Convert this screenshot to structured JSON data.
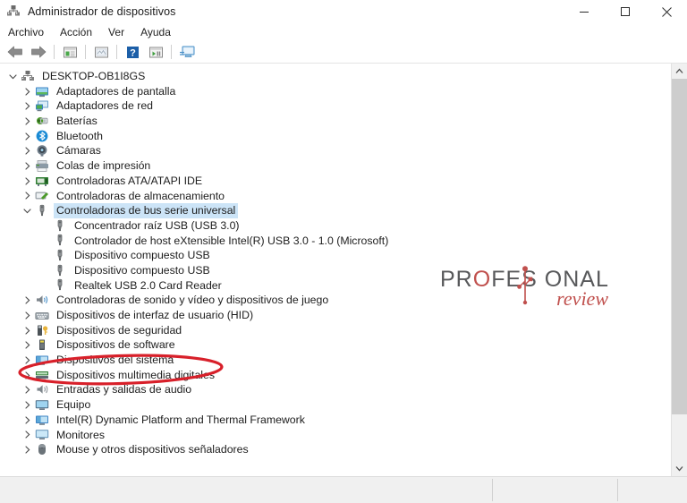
{
  "window": {
    "title": "Administrador de dispositivos",
    "icon": "device-manager-icon",
    "minimize_label": "—",
    "maximize_label": "□",
    "close_label": "✕"
  },
  "menubar": {
    "items": [
      {
        "label": "Archivo",
        "name": "menu-archivo"
      },
      {
        "label": "Acción",
        "name": "menu-accion"
      },
      {
        "label": "Ver",
        "name": "menu-ver"
      },
      {
        "label": "Ayuda",
        "name": "menu-ayuda"
      }
    ]
  },
  "toolbar": {
    "buttons": [
      {
        "name": "back-icon"
      },
      {
        "name": "forward-icon"
      },
      {
        "name": "properties-icon"
      },
      {
        "name": "scan-hardware-icon"
      },
      {
        "name": "help-icon"
      },
      {
        "name": "update-driver-icon"
      },
      {
        "name": "show-hidden-devices-icon"
      }
    ]
  },
  "tree": {
    "root": {
      "label": "DESKTOP-OB1I8GS",
      "expanded": true,
      "icon": "computer-icon"
    },
    "items": [
      {
        "label": "Adaptadores de pantalla",
        "depth": 1,
        "expanded": false,
        "icon": "display-adapter-icon",
        "selected": false
      },
      {
        "label": "Adaptadores de red",
        "depth": 1,
        "expanded": false,
        "icon": "network-adapter-icon",
        "selected": false
      },
      {
        "label": "Baterías",
        "depth": 1,
        "expanded": false,
        "icon": "battery-icon",
        "selected": false
      },
      {
        "label": "Bluetooth",
        "depth": 1,
        "expanded": false,
        "icon": "bluetooth-icon",
        "selected": false
      },
      {
        "label": "Cámaras",
        "depth": 1,
        "expanded": false,
        "icon": "camera-icon",
        "selected": false
      },
      {
        "label": "Colas de impresión",
        "depth": 1,
        "expanded": false,
        "icon": "printer-icon",
        "selected": false
      },
      {
        "label": "Controladoras ATA/ATAPI IDE",
        "depth": 1,
        "expanded": false,
        "icon": "ide-controller-icon",
        "selected": false
      },
      {
        "label": "Controladoras de almacenamiento",
        "depth": 1,
        "expanded": false,
        "icon": "storage-controller-icon",
        "selected": false
      },
      {
        "label": "Controladoras de bus serie universal",
        "depth": 1,
        "expanded": true,
        "icon": "usb-icon",
        "selected": true
      },
      {
        "label": "Concentrador raíz USB (USB 3.0)",
        "depth": 2,
        "expanded": null,
        "icon": "usb-icon",
        "selected": false
      },
      {
        "label": "Controlador de host eXtensible Intel(R) USB 3.0 - 1.0 (Microsoft)",
        "depth": 2,
        "expanded": null,
        "icon": "usb-icon",
        "selected": false
      },
      {
        "label": "Dispositivo compuesto USB",
        "depth": 2,
        "expanded": null,
        "icon": "usb-icon",
        "selected": false
      },
      {
        "label": "Dispositivo compuesto USB",
        "depth": 2,
        "expanded": null,
        "icon": "usb-icon",
        "selected": false
      },
      {
        "label": "Realtek USB 2.0 Card Reader",
        "depth": 2,
        "expanded": null,
        "icon": "usb-icon",
        "selected": false,
        "annotated": true
      },
      {
        "label": "Controladoras de sonido y vídeo y dispositivos de juego",
        "depth": 1,
        "expanded": false,
        "icon": "sound-icon",
        "selected": false
      },
      {
        "label": "Dispositivos de interfaz de usuario (HID)",
        "depth": 1,
        "expanded": false,
        "icon": "hid-icon",
        "selected": false
      },
      {
        "label": "Dispositivos de seguridad",
        "depth": 1,
        "expanded": false,
        "icon": "security-device-icon",
        "selected": false
      },
      {
        "label": "Dispositivos de software",
        "depth": 1,
        "expanded": false,
        "icon": "software-device-icon",
        "selected": false
      },
      {
        "label": "Dispositivos del sistema",
        "depth": 1,
        "expanded": false,
        "icon": "system-device-icon",
        "selected": false
      },
      {
        "label": "Dispositivos multimedia digitales",
        "depth": 1,
        "expanded": false,
        "icon": "multimedia-device-icon",
        "selected": false
      },
      {
        "label": "Entradas y salidas de audio",
        "depth": 1,
        "expanded": false,
        "icon": "audio-io-icon",
        "selected": false
      },
      {
        "label": "Equipo",
        "depth": 1,
        "expanded": false,
        "icon": "computer-monitor-icon",
        "selected": false
      },
      {
        "label": "Intel(R) Dynamic Platform and Thermal Framework",
        "depth": 1,
        "expanded": false,
        "icon": "system-device-icon",
        "selected": false
      },
      {
        "label": "Monitores",
        "depth": 1,
        "expanded": false,
        "icon": "monitor-icon",
        "selected": false
      },
      {
        "label": "Mouse y otros dispositivos señaladores",
        "depth": 1,
        "expanded": false,
        "icon": "mouse-icon",
        "selected": false
      }
    ]
  },
  "annotation": {
    "target_label": "Realtek USB 2.0 Card Reader",
    "shape": "ellipse",
    "color": "#d8202a"
  },
  "watermark": {
    "line1_a": "PR",
    "line1_o": "O",
    "line1_b": "FES",
    "line1_c": "ONAL",
    "line2": "review",
    "color_text": "#58595b",
    "color_accent": "#c0504d"
  },
  "scrollbar": {
    "up_arrow": "▲",
    "down_arrow": "▼"
  },
  "statusbar": {
    "text": ""
  }
}
